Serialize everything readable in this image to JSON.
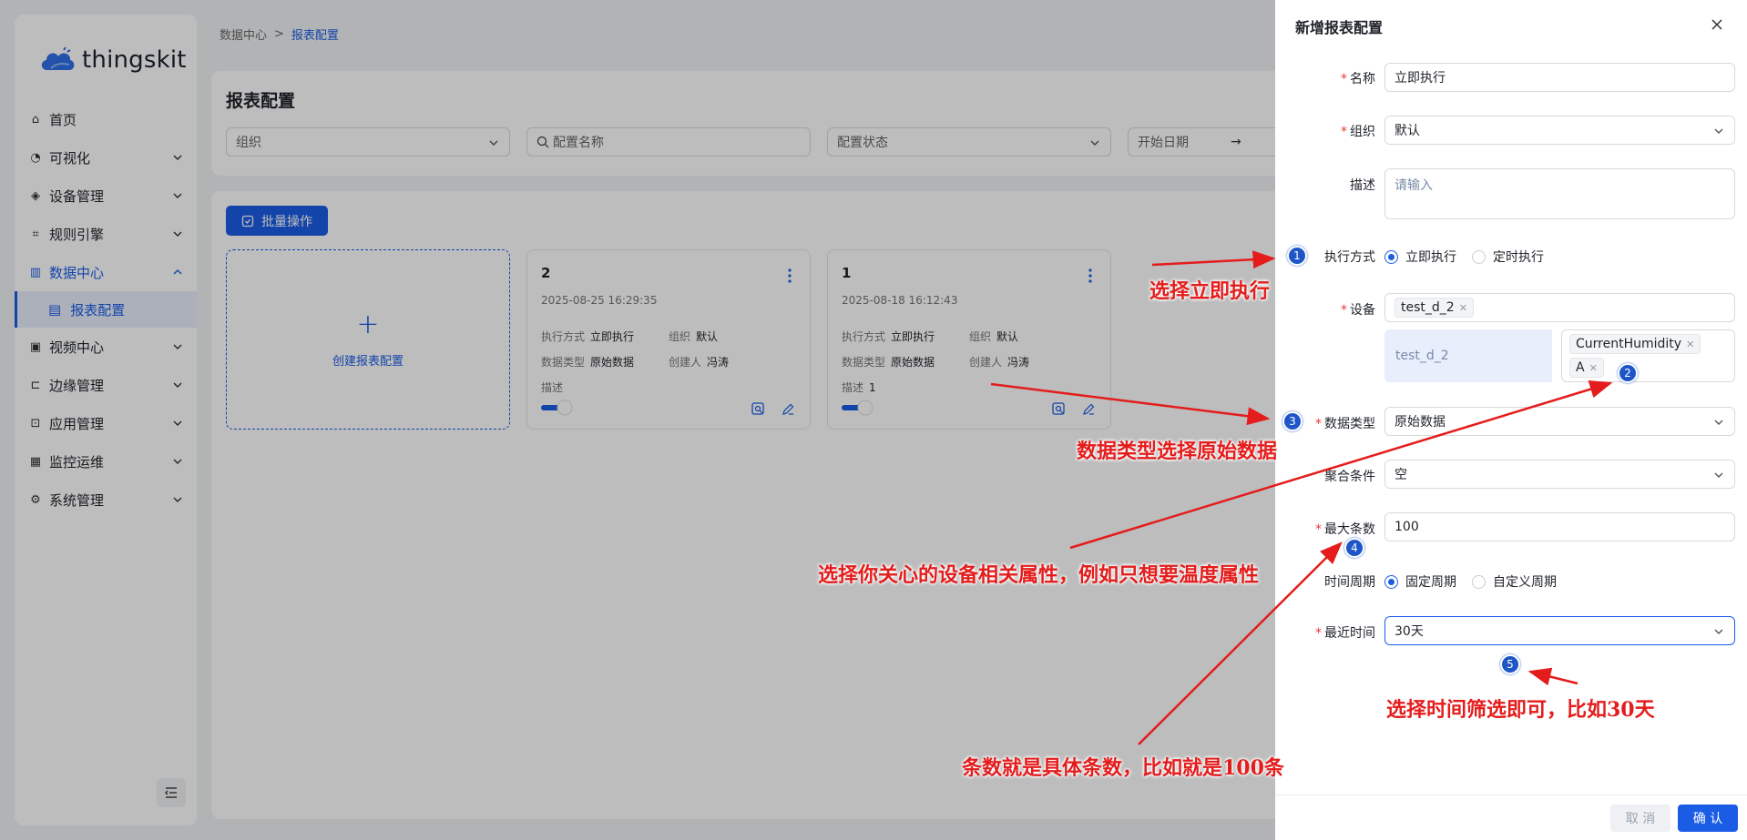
{
  "app": {
    "logo_text": "thingskit"
  },
  "sidebar": {
    "items": [
      {
        "label": "首页",
        "icon": "home-icon",
        "expandable": false
      },
      {
        "label": "可视化",
        "icon": "dashboard-icon",
        "expandable": true
      },
      {
        "label": "设备管理",
        "icon": "device-icon",
        "expandable": true
      },
      {
        "label": "规则引擎",
        "icon": "rule-icon",
        "expandable": true
      },
      {
        "label": "数据中心",
        "icon": "chart-icon",
        "expandable": true,
        "active": true
      },
      {
        "label": "视频中心",
        "icon": "video-icon",
        "expandable": true
      },
      {
        "label": "边缘管理",
        "icon": "edge-icon",
        "expandable": true
      },
      {
        "label": "应用管理",
        "icon": "app-icon",
        "expandable": true
      },
      {
        "label": "监控运维",
        "icon": "monitor-icon",
        "expandable": true
      },
      {
        "label": "系统管理",
        "icon": "settings-icon",
        "expandable": true
      }
    ],
    "submenu_active": "报表配置"
  },
  "breadcrumb": {
    "parent": "数据中心",
    "separator": ">",
    "current": "报表配置"
  },
  "page": {
    "title": "报表配置",
    "filters": {
      "org_placeholder": "组织",
      "name_placeholder": "配置名称",
      "status_placeholder": "配置状态",
      "start_date_placeholder": "开始日期",
      "arrow": "→"
    },
    "batch_label": "批量操作",
    "create_label": "创建报表配置",
    "create_plus": "+"
  },
  "cards": [
    {
      "title": "2",
      "date": "2025-08-25 16:29:35",
      "exec_k": "执行方式",
      "exec_v": "立即执行",
      "org_k": "组织",
      "org_v": "默认",
      "type_k": "数据类型",
      "type_v": "原始数据",
      "creator_k": "创建人",
      "creator_v": "冯涛",
      "desc_k": "描述",
      "desc_v": ""
    },
    {
      "title": "1",
      "date": "2025-08-18 16:12:43",
      "exec_k": "执行方式",
      "exec_v": "立即执行",
      "org_k": "组织",
      "org_v": "默认",
      "type_k": "数据类型",
      "type_v": "原始数据",
      "creator_k": "创建人",
      "creator_v": "冯涛",
      "desc_k": "描述",
      "desc_v": "1"
    }
  ],
  "drawer": {
    "title": "新增报表配置",
    "name_label": "名称",
    "name_value": "立即执行",
    "org_label": "组织",
    "org_value": "默认",
    "desc_label": "描述",
    "desc_placeholder": "请输入",
    "exec_label": "执行方式",
    "exec_opt1": "立即执行",
    "exec_opt2": "定时执行",
    "device_label": "设备",
    "device_tag": "test_d_2",
    "attr_device": "test_d_2",
    "attr_tag1": "CurrentHumidity",
    "attr_tag2": "A",
    "datatype_label": "数据类型",
    "datatype_value": "原始数据",
    "agg_label": "聚合条件",
    "agg_value": "空",
    "max_label": "最大条数",
    "max_value": "100",
    "period_label": "时间周期",
    "period_opt1": "固定周期",
    "period_opt2": "自定义周期",
    "recent_label": "最近时间",
    "recent_value": "30天",
    "cancel_label": "取 消",
    "ok_label": "确 认"
  },
  "annotations": {
    "a1": "选择立即执行",
    "a3": "数据类型选择原始数据",
    "a2": "选择你关心的设备相关属性，例如只想要温度属性",
    "a5": "选择时间筛选即可，比如30天",
    "a4": "条数就是具体条数，比如就是100条",
    "b1": "1",
    "b2": "2",
    "b3": "3",
    "b4": "4",
    "b5": "5"
  },
  "colors": {
    "primary": "#1a5ce6",
    "annotation": "#e41c1c",
    "badge": "#1e56c8"
  }
}
